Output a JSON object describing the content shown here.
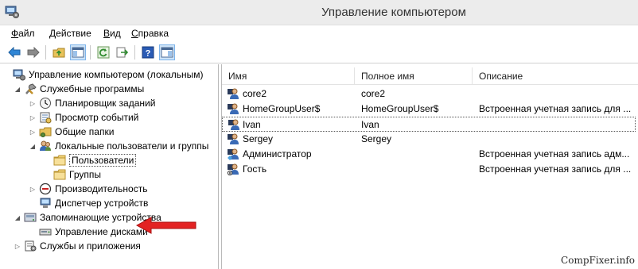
{
  "window": {
    "title": "Управление компьютером"
  },
  "menu": {
    "items": [
      {
        "label": "Файл",
        "underline": "Ф",
        "rest": "айл"
      },
      {
        "label": "Действие",
        "underline": "Д",
        "rest": "ействие"
      },
      {
        "label": "Вид",
        "underline": "В",
        "rest": "ид"
      },
      {
        "label": "Справка",
        "underline": "С",
        "rest": "правка"
      }
    ]
  },
  "toolbar": {
    "buttons": [
      "back-icon",
      "forward-icon",
      "up-folder-icon",
      "show-tree-icon",
      "refresh-icon",
      "export-icon",
      "help-icon",
      "properties-icon"
    ]
  },
  "tree": {
    "items": [
      {
        "label": "Управление компьютером (локальным)",
        "icon": "computer-management-icon",
        "expander": "",
        "level": 0
      },
      {
        "label": "Служебные программы",
        "icon": "tools-icon",
        "expander": "◢",
        "level": 1
      },
      {
        "label": "Планировщик заданий",
        "icon": "clock-icon",
        "expander": "▷",
        "level": 2
      },
      {
        "label": "Просмотр событий",
        "icon": "event-viewer-icon",
        "expander": "▷",
        "level": 2
      },
      {
        "label": "Общие папки",
        "icon": "shared-folder-icon",
        "expander": "▷",
        "level": 2
      },
      {
        "label": "Локальные пользователи и группы",
        "icon": "users-groups-icon",
        "expander": "◢",
        "level": 2
      },
      {
        "label": "Пользователи",
        "icon": "folder-icon",
        "expander": "",
        "level": 3,
        "selected": true
      },
      {
        "label": "Группы",
        "icon": "folder-icon",
        "expander": "",
        "level": 3
      },
      {
        "label": "Производительность",
        "icon": "performance-icon",
        "expander": "▷",
        "level": 2
      },
      {
        "label": "Диспетчер устройств",
        "icon": "device-manager-icon",
        "expander": "",
        "level": 2
      },
      {
        "label": "Запоминающие устройства",
        "icon": "storage-icon",
        "expander": "◢",
        "level": 1
      },
      {
        "label": "Управление дисками",
        "icon": "disk-icon",
        "expander": "",
        "level": 2
      },
      {
        "label": "Службы и приложения",
        "icon": "services-icon",
        "expander": "▷",
        "level": 1
      }
    ]
  },
  "list": {
    "columns": [
      "Имя",
      "Полное имя",
      "Описание"
    ],
    "rows": [
      {
        "name": "core2",
        "full_name": "core2",
        "description": "",
        "icon": "user-icon"
      },
      {
        "name": "HomeGroupUser$",
        "full_name": "HomeGroupUser$",
        "description": "Встроенная учетная запись для ...",
        "icon": "user-icon"
      },
      {
        "name": "Ivan",
        "full_name": "Ivan",
        "description": "",
        "icon": "user-icon",
        "focused": true
      },
      {
        "name": "Sergey",
        "full_name": "Sergey",
        "description": "",
        "icon": "user-icon"
      },
      {
        "name": "Администратор",
        "full_name": "",
        "description": "Встроенная учетная запись адм...",
        "icon": "admin-user-icon"
      },
      {
        "name": "Гость",
        "full_name": "",
        "description": "Встроенная учетная запись для ...",
        "icon": "guest-user-icon"
      }
    ]
  },
  "annotation": {
    "color": "#e32222"
  },
  "watermark": "CompFixer.info"
}
